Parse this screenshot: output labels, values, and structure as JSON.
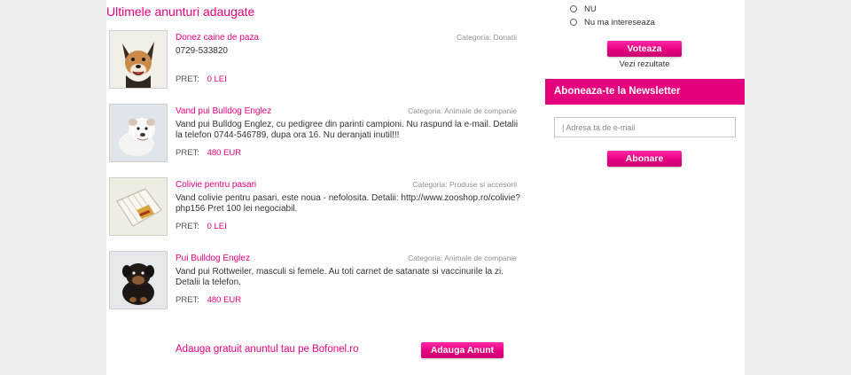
{
  "main": {
    "title": "Ultimele anunturi adaugate",
    "price_label": "PRET:",
    "listings": [
      {
        "title": "Donez caine de paza",
        "category": "Categoria: Donatii",
        "description": "0729-533820",
        "price": "0 LEI",
        "image": "dog-photo"
      },
      {
        "title": "Vand pui Bulldog Englez",
        "category": "Categoria: Animale de companie",
        "description": "Vand pui Bulldog Englez, cu pedigree din parinti campioni. Nu raspund la e-mail. Detalii la telefon 0744-546789, dupa ora 16. Nu deranjati inutil!!!",
        "price": "480 EUR",
        "image": "bulldog-puppy-photo"
      },
      {
        "title": "Colivie pentru pasari",
        "category": "Categoria: Produse si accesorii",
        "description": "Vand colivie pentru pasari, este noua - nefolosita. Detalii: http://www.zooshop.ro/colivie?php156 Pret 100 lei negociabil.",
        "price": "0 LEI",
        "image": "bird-cage-photo"
      },
      {
        "title": "Pui Bulldog Englez",
        "category": "Categoria: Animale de companie",
        "description": "Vand pui Rottweiler, masculi si femele. Au toti carnet de satanate si vaccinurile la zi. Detalii la telefon.",
        "price": "480 EUR",
        "image": "rottweiler-puppy-photo"
      }
    ],
    "add_text": "Adauga gratuit anuntul tau pe Bofonel.ro",
    "add_button": "Adauga Anunt"
  },
  "sidebar": {
    "poll_options": [
      "NU",
      "Nu ma intereseaza"
    ],
    "vote_button": "Voteaza",
    "results_link": "Vezi rezultate",
    "newsletter_title": "Aboneaza-te la Newsletter",
    "email_placeholder": "| Adresa ta de e-mail",
    "subscribe_button": "Abonare"
  },
  "colors": {
    "accent": "#e5007e",
    "background": "#eeeeee",
    "panel": "#ffffff"
  }
}
